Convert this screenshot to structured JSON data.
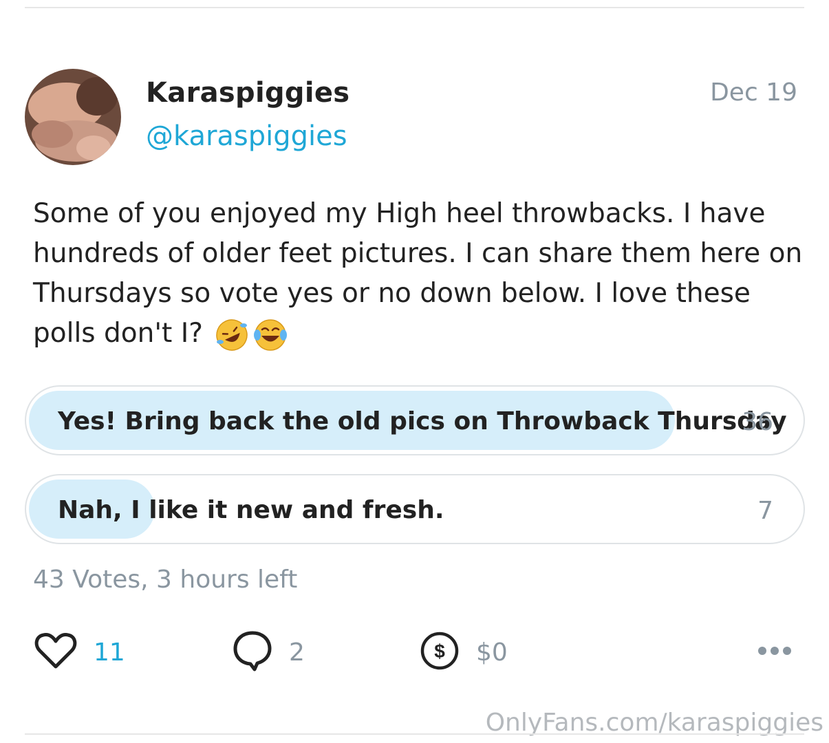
{
  "post": {
    "author_name": "Karaspiggies",
    "author_handle": "@karaspiggies",
    "date": "Dec 19",
    "text": "Some of you enjoyed my High heel throwbacks. I have hundreds of older feet pictures. I can share them here on Thursdays so vote yes or no down below. I love these polls don't I?",
    "emojis": [
      "rolling-on-floor-laughing-emoji",
      "tears-of-joy-emoji"
    ]
  },
  "poll": {
    "options": [
      {
        "label": "Yes! Bring back the old pics on Throwback Thursday",
        "votes": "36",
        "fraction": 0.837
      },
      {
        "label": "Nah, I like it new and fresh.",
        "votes": "7",
        "fraction": 0.163
      }
    ],
    "votes_label": "43 Votes",
    "time_left": ", 3 hours left"
  },
  "actions": {
    "likes": "11",
    "comments": "2",
    "tips": "$0"
  },
  "watermark": "OnlyFans.com/karaspiggies",
  "colors": {
    "accent": "#1fa7d6",
    "poll_fill": "#d6eefa",
    "muted": "#8a96a0"
  }
}
